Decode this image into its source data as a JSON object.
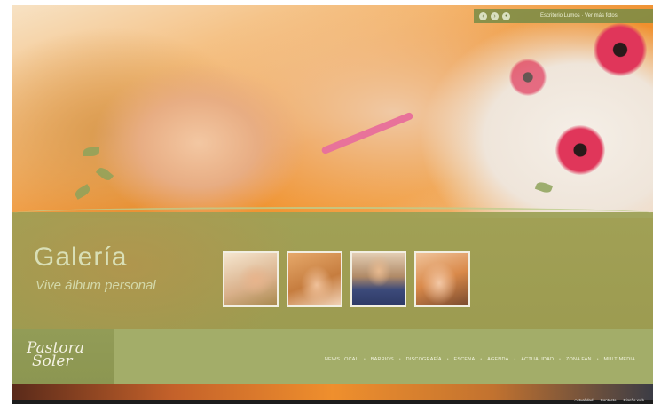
{
  "topbar": {
    "icons": [
      "circle-prev-icon",
      "circle-next-icon",
      "circle-pause-icon"
    ],
    "link_text": "Escritorio Lumos · Ver más fotos"
  },
  "gallery": {
    "title": "Galería",
    "subtitle": "Vive álbum personal"
  },
  "thumbnails": [
    "photo-1",
    "photo-2",
    "photo-3",
    "photo-4"
  ],
  "logo": {
    "line1": "Pastora",
    "line2": "Soler"
  },
  "nav": {
    "items": [
      "NEWS LOCAL",
      "BARRIOS",
      "DISCOGRAFÍA",
      "ESCENA",
      "AGENDA",
      "ACTUALIDAD",
      "ZONA FAN",
      "MULTIMEDIA"
    ]
  },
  "footer": {
    "links": [
      "Actualidad",
      "Contacto",
      "Diseño web"
    ]
  },
  "colors": {
    "band": "#9ba055",
    "navbar": "#a3ad69",
    "text_light": "#f2f4e0"
  }
}
